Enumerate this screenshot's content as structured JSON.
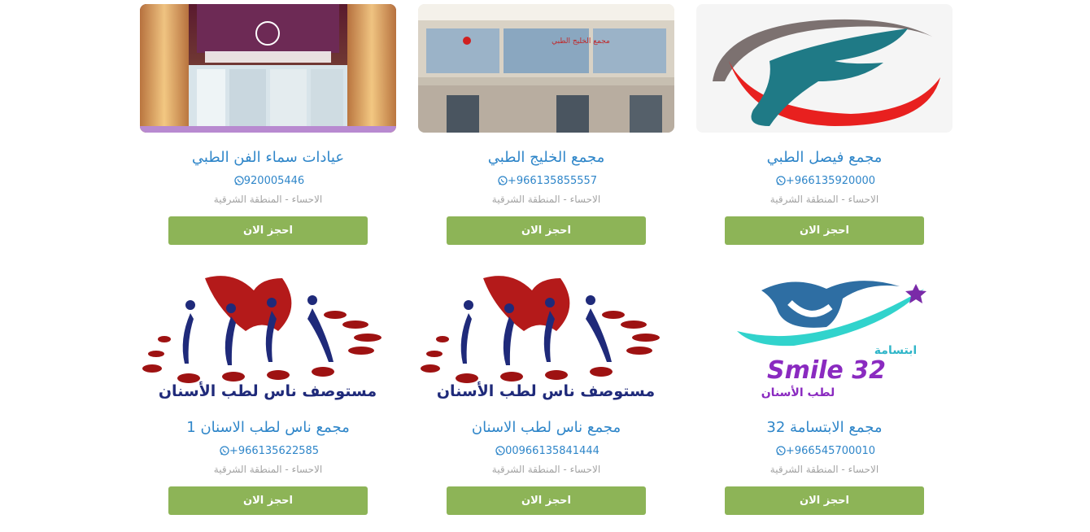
{
  "clinics": [
    {
      "name": "عيادات سماء الفن الطبي",
      "phone": "920005446",
      "location": "الاحساء - المنطقة الشرقية",
      "book_label": "احجز الان",
      "image_icon": "storefront-photo"
    },
    {
      "name": "مجمع الخليج الطبي",
      "phone": "+966135855557",
      "location": "الاحساء - المنطقة الشرقية",
      "book_label": "احجز الان",
      "image_icon": "building-photo",
      "image_sign_text": "مجمع الخليج الطبي"
    },
    {
      "name": "مجمع فيصل الطبي",
      "phone": "+966135920000",
      "location": "الاحساء - المنطقة الشرقية",
      "book_label": "احجز الان",
      "image_icon": "f-swoosh-logo"
    },
    {
      "name": "مجمع ناس لطب الاسنان 1",
      "phone": "+966135622585",
      "location": "الاحساء - المنطقة الشرقية",
      "book_label": "احجز الان",
      "image_icon": "tooth-people-logo",
      "logo_text": "مستوصف ناس لطب الأسنان"
    },
    {
      "name": "مجمع ناس لطب الاسنان",
      "phone": "00966135841444",
      "location": "الاحساء - المنطقة الشرقية",
      "book_label": "احجز الان",
      "image_icon": "tooth-people-logo",
      "logo_text": "مستوصف ناس لطب الأسنان"
    },
    {
      "name": "مجمع الابتسامة 32",
      "phone": "+966545700010",
      "location": "الاحساء - المنطقة الشرقية",
      "book_label": "احجز الان",
      "image_icon": "smile-32-logo",
      "logo_text": "Smile 32",
      "logo_subtext": "لطب الأسنان",
      "logo_arabic": "ابتسامة"
    }
  ],
  "colors": {
    "accent": "#2f86c9",
    "button": "#8db457",
    "muted": "#a3a3a3"
  },
  "icons": {
    "phone": "whatsapp-icon"
  }
}
